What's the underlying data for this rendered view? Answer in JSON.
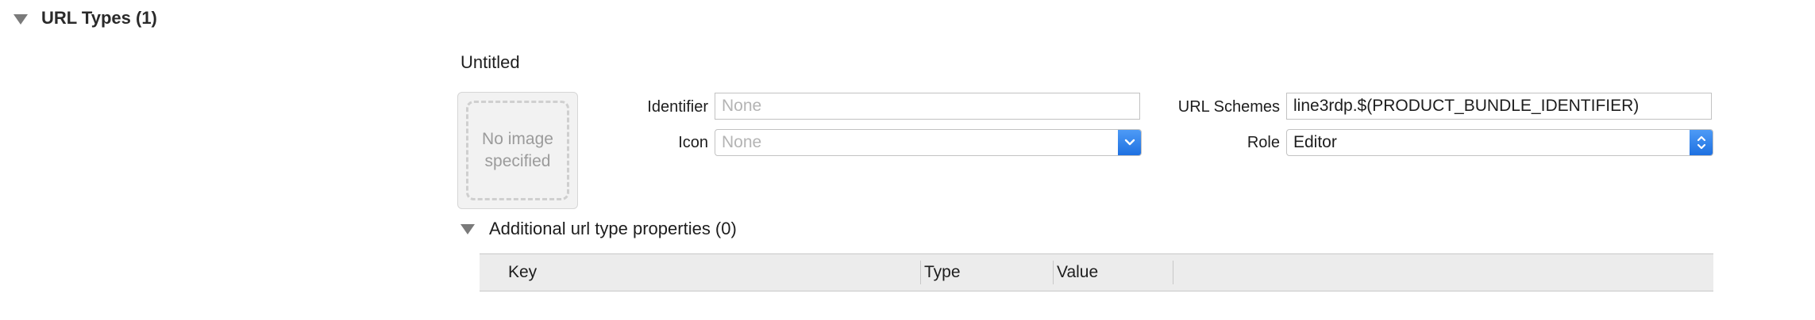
{
  "section": {
    "title": "URL Types (1)"
  },
  "url_type": {
    "title": "Untitled",
    "image_well": {
      "placeholder_text": "No image specified"
    },
    "identifier": {
      "label": "Identifier",
      "value": "",
      "placeholder": "None"
    },
    "icon": {
      "label": "Icon",
      "value": "None",
      "is_placeholder": true
    },
    "url_schemes": {
      "label": "URL Schemes",
      "value": "line3rdp.$(PRODUCT_BUNDLE_IDENTIFIER)"
    },
    "role": {
      "label": "Role",
      "value": "Editor"
    }
  },
  "additional_properties": {
    "title": "Additional url type properties (0)",
    "columns": [
      "Key",
      "Type",
      "Value"
    ]
  },
  "colors": {
    "accent": "#1d6fe0",
    "header_bg": "#ececec"
  }
}
